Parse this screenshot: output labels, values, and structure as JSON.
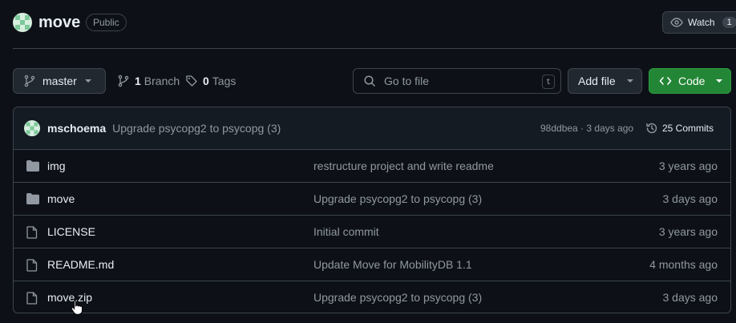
{
  "repo": {
    "name": "move",
    "visibility": "Public",
    "avatar_icon": "identicon-avatar",
    "watch_label": "Watch",
    "watch_count": "1"
  },
  "toolbar": {
    "branch_name": "master",
    "branch_count": "1",
    "branch_label": "Branch",
    "tag_count": "0",
    "tag_label": "Tags",
    "goto_placeholder": "Go to file",
    "goto_shortcut": "t",
    "add_file_label": "Add file",
    "code_label": "Code"
  },
  "latest_commit": {
    "author": "mschoema",
    "message": "Upgrade psycopg2 to psycopg (3)",
    "hash_and_time": "98ddbea · 3 days ago",
    "commit_count": "25 Commits"
  },
  "files": [
    {
      "type": "folder",
      "name": "img",
      "message": "restructure project and write readme",
      "age": "3 years ago"
    },
    {
      "type": "folder",
      "name": "move",
      "message": "Upgrade psycopg2 to psycopg (3)",
      "age": "3 days ago"
    },
    {
      "type": "file",
      "name": "LICENSE",
      "message": "Initial commit",
      "age": "3 years ago"
    },
    {
      "type": "file",
      "name": "README.md",
      "message": "Update Move for MobilityDB 1.1",
      "age": "4 months ago"
    },
    {
      "type": "file",
      "name": "move.zip",
      "message": "Upgrade psycopg2 to psycopg (3)",
      "age": "3 days ago"
    }
  ],
  "colors": {
    "background": "#0d1117",
    "border": "#3d444d",
    "primary_green": "#238636",
    "muted_text": "#9198a1",
    "folder_icon": "#9198a1"
  }
}
